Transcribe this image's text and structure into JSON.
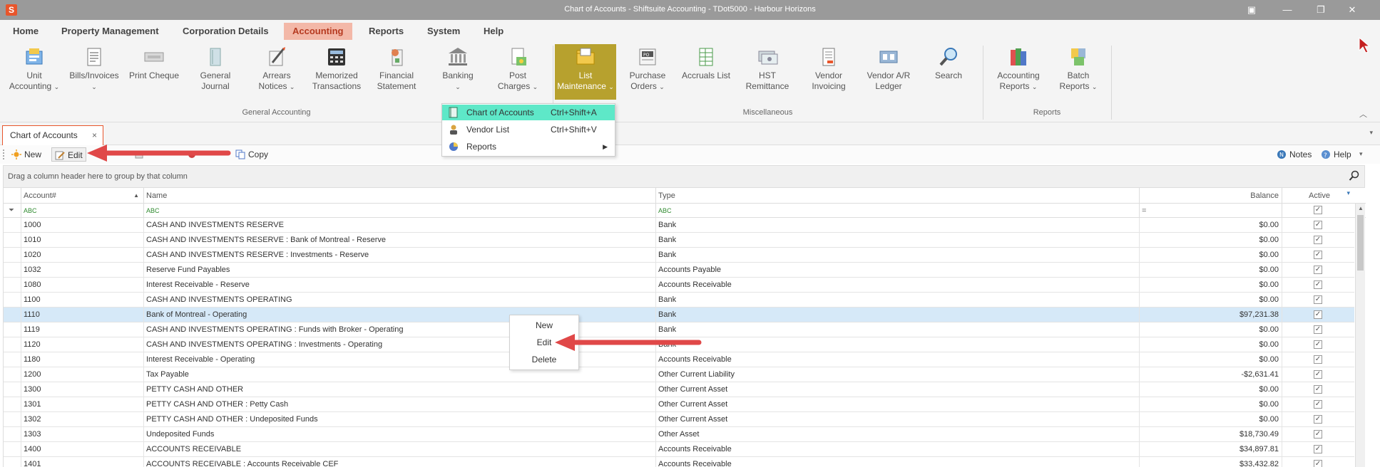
{
  "window": {
    "title": "Chart of Accounts - Shiftsuite Accounting - TDot5000 - Harbour Horizons",
    "app_icon": "S"
  },
  "menubar": {
    "items": [
      "Home",
      "Property Management",
      "Corporation Details",
      "Accounting",
      "Reports",
      "System",
      "Help"
    ],
    "active": "Accounting"
  },
  "ribbon": {
    "buttons": [
      {
        "label1": "Unit",
        "label2": "Accounting",
        "dropdown": true,
        "icon": "unit-accounting-icon"
      },
      {
        "label1": "Bills/Invoices",
        "label2": "",
        "dropdown": true,
        "icon": "bills-invoices-icon"
      },
      {
        "label1": "Print Cheque",
        "label2": "",
        "dropdown": false,
        "icon": "print-cheque-icon"
      },
      {
        "label1": "General",
        "label2": "Journal",
        "dropdown": false,
        "icon": "general-journal-icon"
      },
      {
        "label1": "Arrears",
        "label2": "Notices",
        "dropdown": true,
        "icon": "arrears-notices-icon"
      },
      {
        "label1": "Memorized",
        "label2": "Transactions",
        "dropdown": false,
        "icon": "memorized-transactions-icon"
      },
      {
        "label1": "Financial",
        "label2": "Statement",
        "dropdown": false,
        "icon": "financial-statement-icon"
      },
      {
        "label1": "Banking",
        "label2": "",
        "dropdown": true,
        "icon": "banking-icon"
      },
      {
        "label1": "Post",
        "label2": "Charges",
        "dropdown": true,
        "icon": "post-charges-icon"
      },
      {
        "label1": "List",
        "label2": "Maintenance",
        "dropdown": true,
        "icon": "list-maintenance-icon"
      },
      {
        "label1": "Purchase",
        "label2": "Orders",
        "dropdown": true,
        "icon": "purchase-orders-icon"
      },
      {
        "label1": "Accruals List",
        "label2": "",
        "dropdown": false,
        "icon": "accruals-list-icon"
      },
      {
        "label1": "HST",
        "label2": "Remittance",
        "dropdown": false,
        "icon": "hst-remittance-icon"
      },
      {
        "label1": "Vendor",
        "label2": "Invoicing",
        "dropdown": false,
        "icon": "vendor-invoicing-icon"
      },
      {
        "label1": "Vendor A/R",
        "label2": "Ledger",
        "dropdown": false,
        "icon": "vendor-ar-ledger-icon"
      },
      {
        "label1": "Search",
        "label2": "",
        "dropdown": false,
        "icon": "search-icon"
      },
      {
        "label1": "Accounting",
        "label2": "Reports",
        "dropdown": true,
        "icon": "accounting-reports-icon"
      },
      {
        "label1": "Batch",
        "label2": "Reports",
        "dropdown": true,
        "icon": "batch-reports-icon"
      }
    ],
    "groups": [
      "General Accounting",
      "Miscellaneous",
      "Reports"
    ]
  },
  "list_maintenance_menu": {
    "items": [
      {
        "label": "Chart of Accounts",
        "shortcut": "Ctrl+Shift+A",
        "icon": "chart-of-accounts-icon"
      },
      {
        "label": "Vendor List",
        "shortcut": "Ctrl+Shift+V",
        "icon": "vendor-list-icon"
      },
      {
        "label": "Reports",
        "shortcut": "",
        "icon": "reports-icon"
      }
    ]
  },
  "doc_tab": {
    "label": "Chart of Accounts",
    "close": "×"
  },
  "toolbar": {
    "new": "New",
    "edit": "Edit",
    "copy": "Copy",
    "notes": "Notes",
    "help": "Help"
  },
  "grid": {
    "group_panel_text": "Drag a column header here to group by that column",
    "columns": [
      "Account#",
      "Name",
      "Type",
      "Balance",
      "Active"
    ],
    "filter_symbol": "ABC",
    "rows": [
      {
        "account": "1000",
        "name": "CASH AND INVESTMENTS RESERVE",
        "type": "Bank",
        "balance": "$0.00"
      },
      {
        "account": "1010",
        "name": "CASH AND INVESTMENTS RESERVE : Bank of Montreal - Reserve",
        "type": "Bank",
        "balance": "$0.00"
      },
      {
        "account": "1020",
        "name": "CASH AND INVESTMENTS RESERVE : Investments - Reserve",
        "type": "Bank",
        "balance": "$0.00"
      },
      {
        "account": "1032",
        "name": "Reserve Fund Payables",
        "type": "Accounts Payable",
        "balance": "$0.00"
      },
      {
        "account": "1080",
        "name": "Interest Receivable - Reserve",
        "type": "Accounts Receivable",
        "balance": "$0.00"
      },
      {
        "account": "1100",
        "name": "CASH AND INVESTMENTS OPERATING",
        "type": "Bank",
        "balance": "$0.00"
      },
      {
        "account": "1110",
        "name": "Bank of Montreal - Operating",
        "type": "Bank",
        "balance": "$97,231.38"
      },
      {
        "account": "1119",
        "name": "CASH AND INVESTMENTS OPERATING : Funds with Broker - Operating",
        "type": "Bank",
        "balance": "$0.00"
      },
      {
        "account": "1120",
        "name": "CASH AND INVESTMENTS OPERATING : Investments - Operating",
        "type": "Bank",
        "balance": "$0.00"
      },
      {
        "account": "1180",
        "name": "Interest Receivable - Operating",
        "type": "Accounts Receivable",
        "balance": "$0.00"
      },
      {
        "account": "1200",
        "name": "Tax Payable",
        "type": "Other Current Liability",
        "balance": "-$2,631.41"
      },
      {
        "account": "1300",
        "name": "PETTY CASH AND OTHER",
        "type": "Other Current Asset",
        "balance": "$0.00"
      },
      {
        "account": "1301",
        "name": "PETTY CASH AND OTHER : Petty Cash",
        "type": "Other Current Asset",
        "balance": "$0.00"
      },
      {
        "account": "1302",
        "name": "PETTY CASH AND OTHER : Undeposited Funds",
        "type": "Other Current Asset",
        "balance": "$0.00"
      },
      {
        "account": "1303",
        "name": "Undeposited Funds",
        "type": "Other Asset",
        "balance": "$18,730.49"
      },
      {
        "account": "1400",
        "name": "ACCOUNTS RECEIVABLE",
        "type": "Accounts Receivable",
        "balance": "$34,897.81"
      },
      {
        "account": "1401",
        "name": "ACCOUNTS RECEIVABLE : Accounts Receivable CEF",
        "type": "Accounts Receivable",
        "balance": "$33,432.82"
      }
    ],
    "selected_account": "1110",
    "check_glyph": "✓"
  },
  "context_menu": {
    "items": [
      "New",
      "Edit",
      "Delete"
    ]
  },
  "colors": {
    "accent": "#e8552b",
    "list_highlight": "#b7a12e",
    "menu_highlight": "#5ee8c8",
    "selected_row": "#d6e9f8",
    "arrow": "#e04848"
  }
}
